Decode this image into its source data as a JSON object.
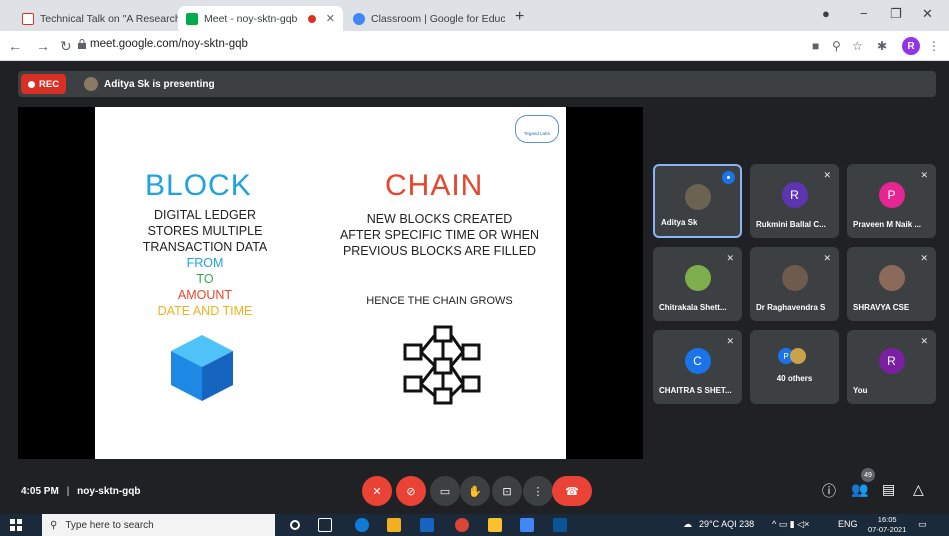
{
  "browser": {
    "tabs": [
      {
        "title": "Technical Talk on \"A Research pa",
        "active": false,
        "favicon": "gmail-icon"
      },
      {
        "title": "Meet - noy-sktn-gqb",
        "active": true,
        "favicon": "meet-icon"
      },
      {
        "title": "Classroom | Google for Educatio",
        "active": false,
        "favicon": "google-icon"
      }
    ],
    "new_tab": "+",
    "url": "meet.google.com/noy-sktn-gqb",
    "profile_initial": "R"
  },
  "meet": {
    "rec_label": "REC",
    "presenting_text": "Aditya Sk is presenting",
    "slide": {
      "logo_text": "Tegand Labs",
      "block_title": "BLOCK",
      "chain_title": "CHAIN",
      "left_lines": [
        "DIGITAL LEDGER",
        "STORES MULTIPLE",
        "TRANSACTION DATA"
      ],
      "from": "FROM",
      "to": "TO",
      "amount": "AMOUNT",
      "date": "DATE AND TIME",
      "right_lines": [
        "NEW BLOCKS CREATED",
        "AFTER SPECIFIC TIME OR WHEN",
        "PREVIOUS BLOCKS ARE FILLED"
      ],
      "hence": "HENCE THE CHAIN  GROWS"
    },
    "participants": [
      {
        "name": "Aditya Sk",
        "initial": "",
        "avatar": "photo1",
        "color": "#6b6252",
        "speaking": true
      },
      {
        "name": "Rukmini Ballal C...",
        "initial": "R",
        "avatar": "letter",
        "color": "#5e35b1",
        "speaking": false
      },
      {
        "name": "Praveen M Naik ...",
        "initial": "P",
        "avatar": "letter",
        "color": "#e52592",
        "speaking": false
      },
      {
        "name": "Chitrakala Shett...",
        "initial": "",
        "avatar": "photo2",
        "color": "#7fae4c",
        "speaking": false
      },
      {
        "name": "Dr Raghavendra S",
        "initial": "",
        "avatar": "photo3",
        "color": "#6f5a4e",
        "speaking": false
      },
      {
        "name": "SHRAVYA CSE",
        "initial": "",
        "avatar": "photo4",
        "color": "#8c6a5a",
        "speaking": false
      },
      {
        "name": "CHAITRA S SHET...",
        "initial": "C",
        "avatar": "letter",
        "color": "#1a73e8",
        "speaking": false
      },
      {
        "name": "40 others",
        "initial": "P",
        "avatar": "group",
        "color": "#1a73e8",
        "speaking": false
      },
      {
        "name": "You",
        "initial": "R",
        "avatar": "letter",
        "color": "#7b1fa2",
        "speaking": false
      }
    ],
    "time": "4:05 PM",
    "meeting_code": "noy-sktn-gqb",
    "people_count": "49"
  },
  "taskbar": {
    "search_placeholder": "Type here to search",
    "weather": "29°C  AQI 238",
    "language": "ENG",
    "time": "16:05",
    "date": "07-07-2021"
  }
}
